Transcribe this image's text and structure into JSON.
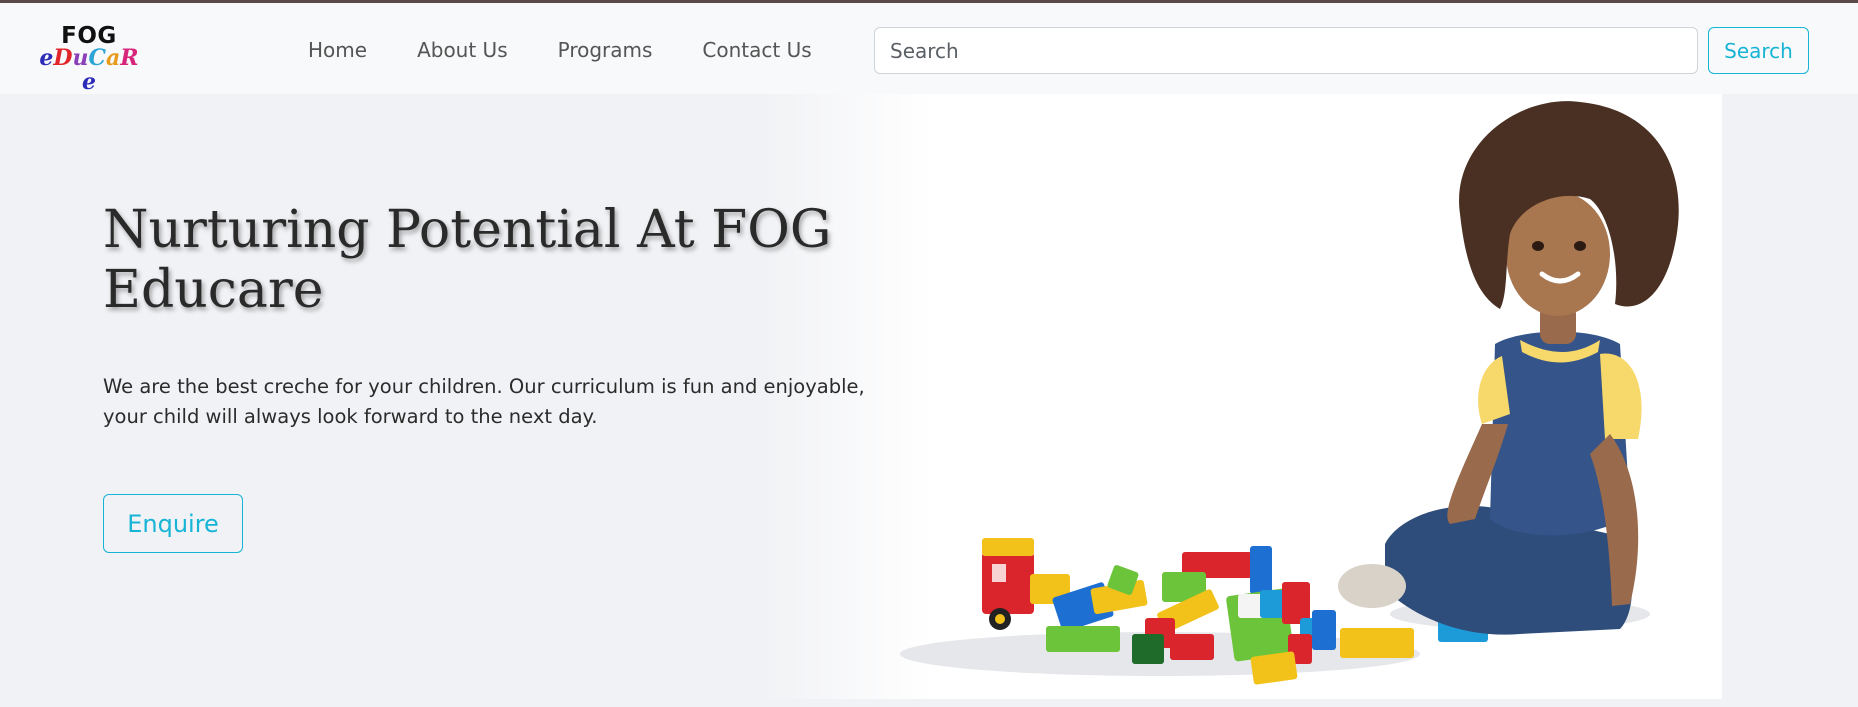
{
  "header": {
    "logo": {
      "top_text": "FOG",
      "bottom_letters": [
        {
          "char": "e",
          "color": "#2b2bb8"
        },
        {
          "char": "D",
          "color": "#e0252b"
        },
        {
          "char": "u",
          "color": "#8a3fb8"
        },
        {
          "char": "C",
          "color": "#2aa5d6"
        },
        {
          "char": "a",
          "color": "#e89a1a"
        },
        {
          "char": "R",
          "color": "#d6257a"
        },
        {
          "char": "e",
          "color": "#2b2bb8"
        }
      ]
    },
    "nav": [
      {
        "label": "Home"
      },
      {
        "label": "About Us"
      },
      {
        "label": "Programs"
      },
      {
        "label": "Contact Us"
      }
    ],
    "search": {
      "placeholder": "Search",
      "button_label": "Search"
    }
  },
  "hero": {
    "title": "Nurturing Potential At FOG Educare",
    "text": "We are the best creche for your children. Our curriculum is fun and enjoyable, your child will always look forward to the next day.",
    "button_label": "Enquire",
    "image_icon": "child-playing-with-blocks-illustration"
  },
  "colors": {
    "accent": "#17b4d6",
    "page_bg": "#f1f2f5",
    "nav_bg": "#f8f9fa"
  }
}
